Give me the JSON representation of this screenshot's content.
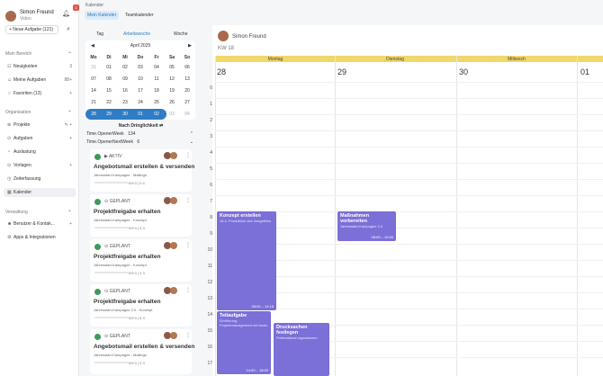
{
  "user": {
    "name": "Simon Freund",
    "role": "Video"
  },
  "badge_count": "1",
  "buttons": {
    "new_task": "+ Neue Aufgabe (121)"
  },
  "sections": {
    "mein_bereich": "Mein Bereich",
    "organisation": "Organisation",
    "verwaltung": "Verwaltung"
  },
  "nav": {
    "neuigkeiten": {
      "label": "Neuigkeiten",
      "count": "3"
    },
    "meine_aufgaben": {
      "label": "Meine Aufgaben",
      "count": "88+"
    },
    "favoriten": {
      "label": "Favoriten (13)"
    },
    "projekte": {
      "label": "Projekte"
    },
    "aufgaben": {
      "label": "Aufgaben"
    },
    "auslastung": {
      "label": "Auslastung"
    },
    "vorlagen": {
      "label": "Vorlagen"
    },
    "zeiterfassung": {
      "label": "Zeiterfassung"
    },
    "kalender": {
      "label": "Kalender"
    },
    "benutzer": {
      "label": "Benutzer & Kontak..."
    },
    "apps": {
      "label": "Apps & Integrationen"
    }
  },
  "breadcrumb": "Kalender",
  "top_tabs": [
    "Mein Kalender",
    "Teamkalender"
  ],
  "view_tabs": [
    "Tag",
    "Arbeitswoche",
    "Woche"
  ],
  "minical": {
    "month": "April 2025",
    "days": [
      "Mo",
      "Di",
      "Mi",
      "Do",
      "Fr",
      "Sa",
      "So"
    ],
    "weeks": [
      [
        "31",
        "01",
        "02",
        "03",
        "04",
        "05",
        "06"
      ],
      [
        "07",
        "08",
        "09",
        "10",
        "11",
        "12",
        "13"
      ],
      [
        "14",
        "15",
        "16",
        "17",
        "18",
        "19",
        "20"
      ],
      [
        "21",
        "22",
        "23",
        "24",
        "25",
        "26",
        "27"
      ],
      [
        "28",
        "29",
        "30",
        "01",
        "02",
        "03",
        "04"
      ]
    ]
  },
  "group_by": "Nach Dringlichkeit ⇄",
  "groups": [
    {
      "label": "Time.OpenerWeek",
      "count": "134"
    },
    {
      "label": "Time.OpenerNextWeek",
      "count": "6"
    }
  ],
  "tasks": [
    {
      "status": "▶ AKTIV",
      "title": "Angebotsmail erstellen & versenden",
      "subtitle": "Jahresstart-Kampagne - Mailings",
      "meta": "0/9   0 | 0   4"
    },
    {
      "status": "⊙ GEPLANT",
      "title": "Projektfreigabe erhalten",
      "subtitle": "Jahresstart-Kampagne - Konzept",
      "meta": "0/9   0 | 0   3"
    },
    {
      "status": "⊙ GEPLANT",
      "title": "Projektfreigabe erhalten",
      "subtitle": "Jahresstart-Kampagne - Konzept",
      "meta": "0/9   0 | 0   3"
    },
    {
      "status": "⊙ GEPLANT",
      "title": "Projektfreigabe erhalten",
      "subtitle": "Jahresstart-Kampagne 2.0 - Konzept",
      "meta": "0/9   0 | 0   3"
    },
    {
      "status": "⊙ GEPLANT",
      "title": "Angebotsmail erstellen & versenden",
      "subtitle": "Jahresstart-Kampagne - Mailings",
      "meta": "0/9   0 | 0   3"
    }
  ],
  "calendar": {
    "owner": "Simon Freund",
    "week": "KW 18",
    "days": [
      {
        "name": "Montag",
        "date": "28"
      },
      {
        "name": "Dienstag",
        "date": "29"
      },
      {
        "name": "Mittwoch",
        "date": "30"
      },
      {
        "name": "",
        "date": "01"
      }
    ],
    "hours": [
      "0",
      "1",
      "2",
      "3",
      "4",
      "5",
      "6",
      "7",
      "8",
      "9",
      "10",
      "11",
      "12",
      "13",
      "14",
      "15",
      "16",
      "17"
    ],
    "events": [
      {
        "title": "Konzept erstellen",
        "sub": "16.4. Produktion des Imagefilms",
        "time": "08:00 – 14:15"
      },
      {
        "title": "Maßnahmen vorbereiten",
        "sub": "Jahresstart-Kampagne 2.0",
        "time": "08:00 – 10:00"
      },
      {
        "title": "Teilaufgabe",
        "sub": "Einführung Projektmanagement mit factro",
        "time": "14:00 – 18:00"
      },
      {
        "title": "Drucksachen festlegen",
        "sub": "Printmaterial organisieren",
        "time": ""
      }
    ]
  },
  "colors": {
    "accent": "#2f7dc4",
    "event": "#7b6fd8",
    "dayband": "#f1d76a"
  }
}
